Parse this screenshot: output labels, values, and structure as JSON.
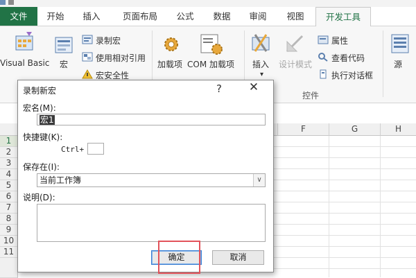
{
  "ribbon": {
    "tabs": [
      {
        "label": "文件"
      },
      {
        "label": "开始"
      },
      {
        "label": "插入"
      },
      {
        "label": "页面布局"
      },
      {
        "label": "公式"
      },
      {
        "label": "数据"
      },
      {
        "label": "审阅"
      },
      {
        "label": "视图"
      },
      {
        "label": "开发工具"
      }
    ],
    "active_tab": "开发工具",
    "code_group": {
      "visual_basic": "Visual Basic",
      "macros": "宏",
      "record_macro": "录制宏",
      "relative_ref": "使用相对引用",
      "macro_security": "宏安全性"
    },
    "addins_group": {
      "addins": "加载项",
      "com_addins": "COM 加载项"
    },
    "controls_group": {
      "insert": "插入",
      "design_mode": "设计模式",
      "properties": "属性",
      "view_code": "查看代码",
      "run_dialog": "执行对话框",
      "group_label": "控件"
    },
    "source": "源"
  },
  "sheet": {
    "columns": [
      "F",
      "G",
      "H"
    ],
    "rows": [
      "1",
      "2",
      "3",
      "4",
      "5",
      "6",
      "7",
      "8",
      "9",
      "10",
      "11"
    ],
    "selected_row": "1"
  },
  "dialog": {
    "title": "录制新宏",
    "help": "?",
    "close": "✕",
    "macro_name_label": "宏名(M):",
    "macro_name_value": "宏1",
    "shortcut_label": "快捷键(K):",
    "shortcut_prefix": "Ctrl+",
    "shortcut_value": "",
    "store_in_label": "保存在(I):",
    "store_in_value": "当前工作簿",
    "description_label": "说明(D):",
    "description_value": "",
    "ok_label": "确定",
    "cancel_label": "取消"
  },
  "colors": {
    "accent": "#217346",
    "highlight": "#e2525a"
  }
}
